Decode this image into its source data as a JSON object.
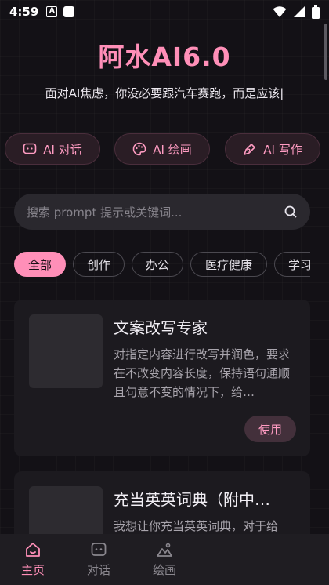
{
  "status_bar": {
    "time": "4:59",
    "notif_letter": "A"
  },
  "app": {
    "title": "阿水AI6.0",
    "subtitle": "面对AI焦虑，你没必要跟汽车赛跑，而是应该|"
  },
  "features": [
    {
      "label": "AI 对话",
      "icon": "chat-bubble-icon"
    },
    {
      "label": "AI 绘画",
      "icon": "palette-icon"
    },
    {
      "label": "AI 写作",
      "icon": "pen-nib-icon"
    }
  ],
  "search": {
    "placeholder": "搜索 prompt 提示或关键词..."
  },
  "categories": [
    "全部",
    "创作",
    "办公",
    "医疗健康",
    "学习"
  ],
  "cards": [
    {
      "title": "文案改写专家",
      "description": "对指定内容进行改写并润色，要求在不改变内容长度，保持语句通顺且句意不变的情况下，给…",
      "action": "使用"
    },
    {
      "title": "充当英英词典（附中…",
      "description": "我想让你充当英英词典，对于给"
    }
  ],
  "nav": [
    {
      "label": "主页",
      "icon": "home-icon"
    },
    {
      "label": "对话",
      "icon": "chat-bubble-icon"
    },
    {
      "label": "绘画",
      "icon": "image-icon"
    }
  ],
  "colors": {
    "accent": "#ff8fb8",
    "background": "#131116",
    "card": "#1c1a1f"
  }
}
